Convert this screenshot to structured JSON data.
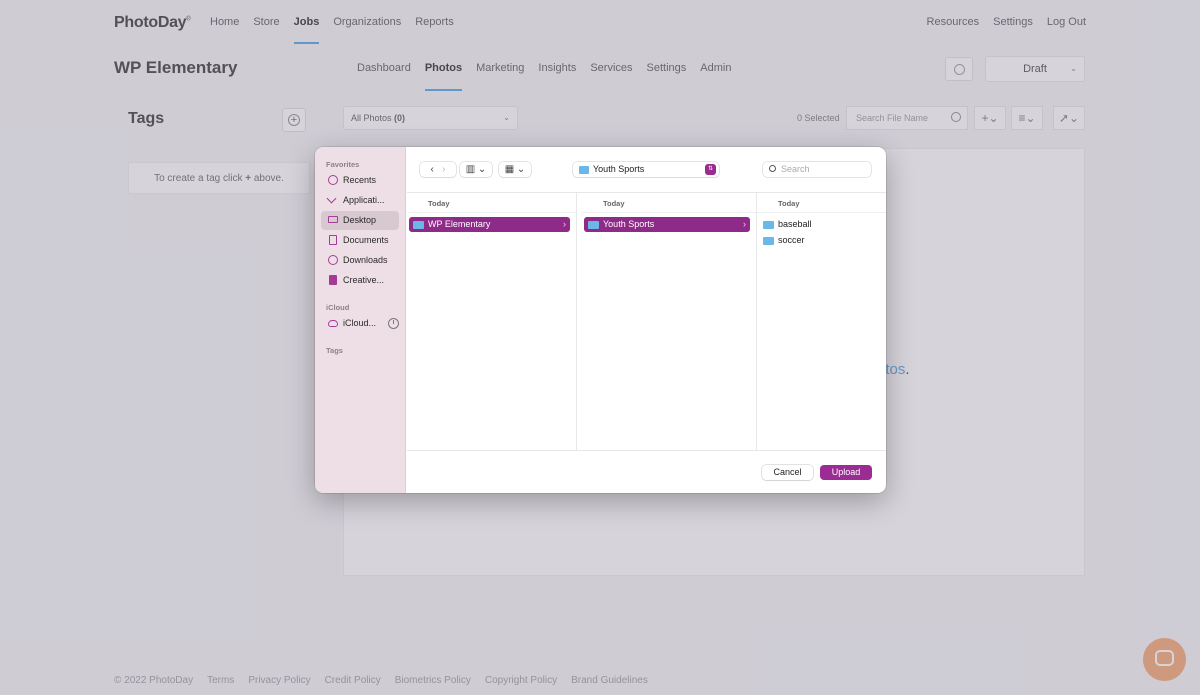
{
  "app": {
    "logo": "PhotoDay",
    "main_nav": [
      "Home",
      "Store",
      "Jobs",
      "Organizations",
      "Reports"
    ],
    "active_main_nav": "Jobs",
    "user_nav": [
      "Resources",
      "Settings",
      "Log Out"
    ],
    "job_title": "WP Elementary",
    "sub_nav": [
      "Dashboard",
      "Photos",
      "Marketing",
      "Insights",
      "Services",
      "Settings",
      "Admin"
    ],
    "active_sub_nav": "Photos",
    "status": "Draft",
    "tags": {
      "title": "Tags",
      "hint_prefix": "To create a tag click ",
      "hint_plus": "+",
      "hint_suffix": " above."
    },
    "photos_filter": {
      "label": "All Photos ",
      "count": "(0)"
    },
    "selected_count": "0 Selected",
    "search_placeholder": "Search File Name",
    "upload_link_fragment": "otos",
    "upload_link_period": ".",
    "footer": [
      "© 2022 PhotoDay",
      "Terms",
      "Privacy Policy",
      "Credit Policy",
      "Biometrics Policy",
      "Copyright Policy",
      "Brand Guidelines"
    ]
  },
  "dialog": {
    "sidebar": {
      "favorites_heading": "Favorites",
      "favorites": [
        {
          "label": "Recents",
          "icon": "clock-icon"
        },
        {
          "label": "Applicati...",
          "icon": "applications-icon"
        },
        {
          "label": "Desktop",
          "icon": "desktop-icon",
          "selected": true
        },
        {
          "label": "Documents",
          "icon": "document-icon"
        },
        {
          "label": "Downloads",
          "icon": "download-icon"
        },
        {
          "label": "Creative...",
          "icon": "file-icon"
        }
      ],
      "icloud_heading": "iCloud",
      "icloud_item": "iCloud...",
      "tags_heading": "Tags"
    },
    "path": "Youth Sports",
    "search_placeholder": "Search",
    "columns": [
      {
        "heading": "Today",
        "items": [
          {
            "name": "WP Elementary",
            "selected": true
          }
        ]
      },
      {
        "heading": "Today",
        "items": [
          {
            "name": "Youth Sports",
            "selected": true
          }
        ]
      },
      {
        "heading": "Today",
        "items": [
          {
            "name": "baseball"
          },
          {
            "name": "soccer"
          }
        ]
      }
    ],
    "cancel_label": "Cancel",
    "upload_label": "Upload",
    "accent_color": "#9a2c93",
    "folder_color": "#6bb7e8"
  }
}
